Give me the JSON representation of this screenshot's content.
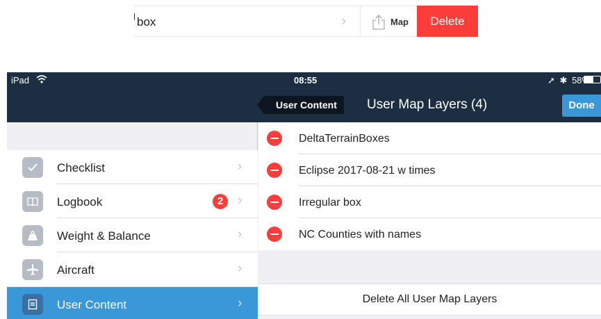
{
  "swipe_example": {
    "row_text": "box",
    "map_label": "Map",
    "delete_label": "Delete"
  },
  "status": {
    "carrier": "iPad",
    "time": "08:55",
    "battery": "58%",
    "battery_level": 0.58
  },
  "nav": {
    "back_label": "User Content",
    "title": "User Map Layers (4)",
    "done_label": "Done"
  },
  "sidebar": {
    "items": [
      {
        "label": "Checklist",
        "icon": "checkmark-icon"
      },
      {
        "label": "Logbook",
        "icon": "book-icon",
        "badge": "2"
      },
      {
        "label": "Weight & Balance",
        "icon": "weight-icon"
      },
      {
        "label": "Aircraft",
        "icon": "airplane-icon"
      },
      {
        "label": "User Content",
        "icon": "document-icon",
        "selected": true
      }
    ]
  },
  "layers": [
    "DeltaTerrainBoxes",
    "Eclipse 2017-08-21 w times",
    "Irregular box",
    "NC Counties with names"
  ],
  "delete_all_label": "Delete All User Map Layers",
  "colors": {
    "navbar": "#1c2e42",
    "accent": "#3a97d8",
    "destructive": "#fc3d39"
  }
}
